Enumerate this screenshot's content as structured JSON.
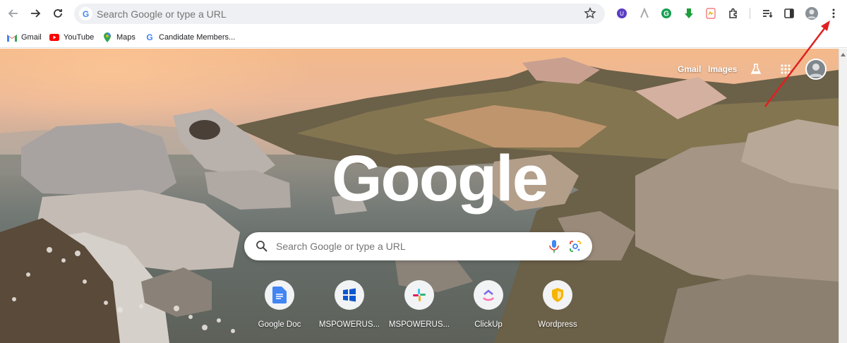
{
  "toolbar": {
    "omnibox_placeholder": "Search Google or type a URL"
  },
  "bookmarks": [
    {
      "label": "Gmail",
      "icon": "gmail-icon"
    },
    {
      "label": "YouTube",
      "icon": "youtube-icon"
    },
    {
      "label": "Maps",
      "icon": "maps-icon"
    },
    {
      "label": "Candidate Members...",
      "icon": "google-icon"
    }
  ],
  "ntp": {
    "links": {
      "gmail": "Gmail",
      "images": "Images"
    },
    "logo": "Google",
    "search_placeholder": "Search Google or type a URL",
    "shortcuts": [
      {
        "label": "Google Doc",
        "icon": "google-docs-icon"
      },
      {
        "label": "MSPOWERUS...",
        "icon": "windows-icon"
      },
      {
        "label": "MSPOWERUS...",
        "icon": "slack-icon"
      },
      {
        "label": "ClickUp",
        "icon": "clickup-icon"
      },
      {
        "label": "Wordpress",
        "icon": "shield-icon"
      }
    ]
  },
  "colors": {
    "accent_arrow": "#e02020",
    "google_blue": "#4285f4",
    "google_red": "#ea4335",
    "google_yellow": "#fbbc05",
    "google_green": "#34a853"
  }
}
